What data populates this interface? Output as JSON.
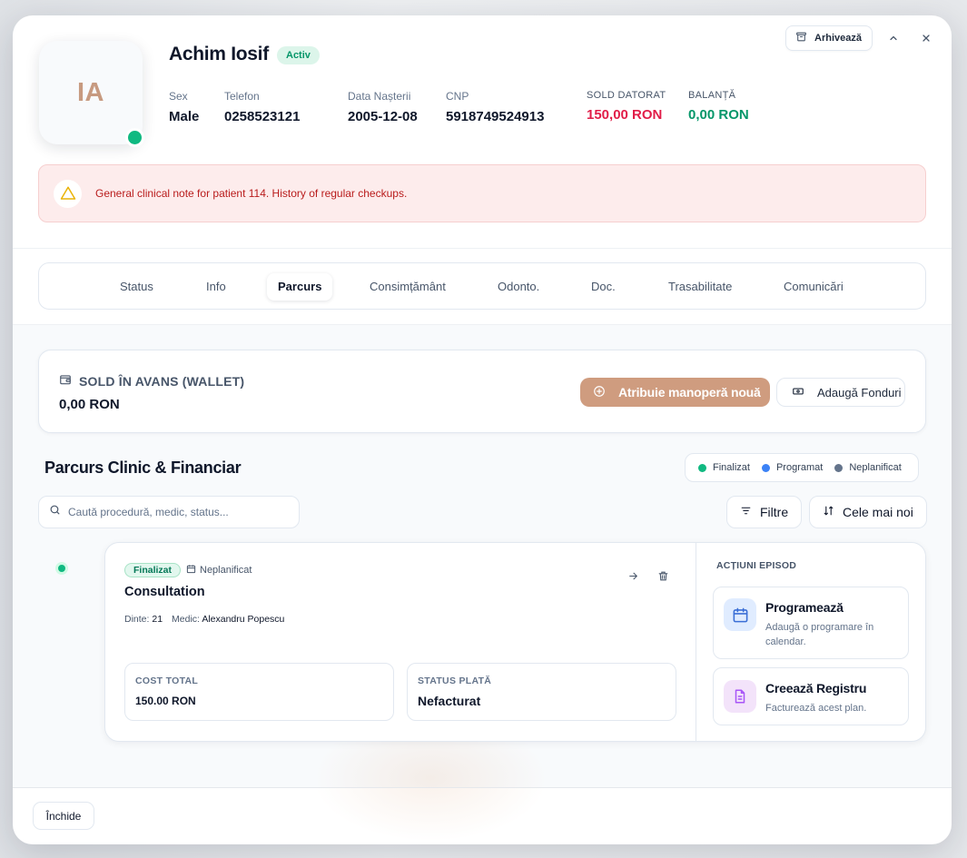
{
  "patient": {
    "initials": "IA",
    "name": "Achim Iosif",
    "status": "Activ",
    "fields": {
      "sex_label": "Sex",
      "sex_value": "Male",
      "phone_label": "Telefon",
      "phone_value": "0258523121",
      "dob_label": "Data Nașterii",
      "dob_value": "2005-12-08",
      "cnp_label": "CNP",
      "cnp_value": "5918749524913",
      "due_label": "SOLD DATORAT",
      "due_value": "150,00 RON",
      "balance_label": "BALANȚĂ",
      "balance_value": "0,00 RON"
    }
  },
  "header_actions": {
    "archive_label": "Arhivează"
  },
  "alert": {
    "text": "General clinical note for patient 114. History of regular checkups."
  },
  "tabs": [
    "Status",
    "Info",
    "Parcurs",
    "Consimțământ",
    "Odonto.",
    "Doc.",
    "Trasabilitate",
    "Comunicări"
  ],
  "active_tab": "Parcurs",
  "wallet": {
    "title": "SOLD ÎN AVANS (WALLET)",
    "amount": "0,00 RON",
    "primary_button": "Atribuie manoperă nouă",
    "secondary_button": "Adaugă Fonduri"
  },
  "section": {
    "title": "Parcurs Clinic & Financiar",
    "legend": [
      {
        "label": "Finalizat",
        "color": "#10b981"
      },
      {
        "label": "Programat",
        "color": "#3b82f6"
      },
      {
        "label": "Neplanificat",
        "color": "#64748b"
      }
    ],
    "search_placeholder": "Caută procedură, medic, status...",
    "filter_label": "Filtre",
    "sort_label": "Cele mai noi"
  },
  "episode": {
    "status_badge": "Finalizat",
    "schedule_badge": "Neplanificat",
    "title": "Consultation",
    "teeth_label": "Dinte:",
    "teeth_value": "21",
    "doctor_label": "Medic:",
    "doctor_value": "Alexandru Popescu",
    "cost_label": "COST TOTAL",
    "cost_value": "150.00 RON",
    "payment_label": "STATUS PLATĂ",
    "payment_value": "Nefacturat",
    "actions_title": "ACȚIUNI EPISOD",
    "action1_title": "Programează",
    "action1_desc": "Adaugă o programare în calendar.",
    "action2_title": "Creează Registru",
    "action2_desc": "Facturează acest plan."
  },
  "footer": {
    "close_label": "Închide"
  },
  "colors": {
    "accent": "#cf9c7f",
    "success": "#10b981",
    "danger": "#e11d48",
    "info": "#3b82f6"
  }
}
